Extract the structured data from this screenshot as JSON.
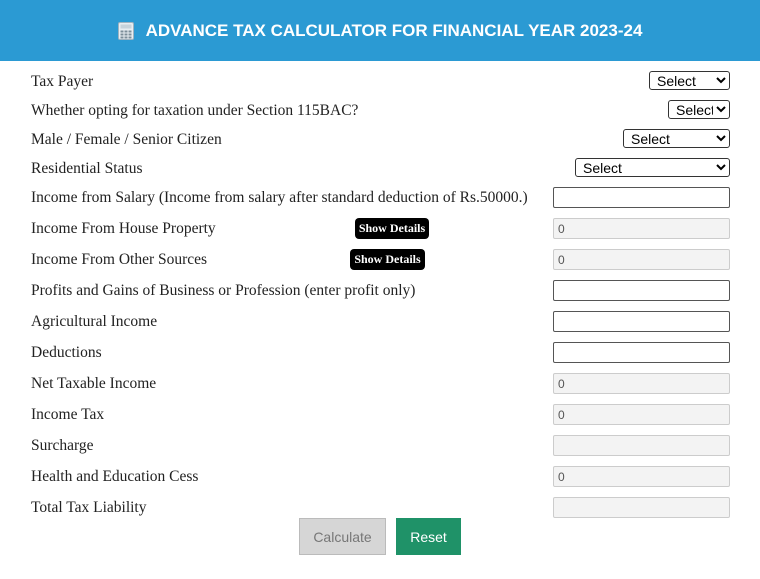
{
  "header": {
    "title": "ADVANCE TAX CALCULATOR FOR FINANCIAL YEAR 2023-24",
    "icon": "calculator-icon"
  },
  "fields": {
    "tax_payer": {
      "label": "Tax Payer",
      "value": "Select"
    },
    "section_115bac": {
      "label": "Whether opting for taxation under Section 115BAC?",
      "value": "Select"
    },
    "gender": {
      "label": "Male / Female / Senior Citizen",
      "value": "Select"
    },
    "residential_status": {
      "label": "Residential Status",
      "value": "Select"
    },
    "salary": {
      "label": "Income from Salary (Income from salary after standard deduction of Rs.50000.)",
      "value": ""
    },
    "house_property": {
      "label": "Income From House Property",
      "button": "Show Details",
      "value": "0"
    },
    "other_sources": {
      "label": "Income From Other Sources",
      "button": "Show Details",
      "value": "0"
    },
    "business": {
      "label": "Profits and Gains of Business or Profession (enter profit only)",
      "value": ""
    },
    "agricultural": {
      "label": "Agricultural Income",
      "value": ""
    },
    "deductions": {
      "label": "Deductions",
      "value": ""
    },
    "net_taxable": {
      "label": "Net Taxable Income",
      "value": "0"
    },
    "income_tax": {
      "label": "Income Tax",
      "value": "0"
    },
    "surcharge": {
      "label": "Surcharge",
      "value": ""
    },
    "cess": {
      "label": "Health and Education Cess",
      "value": "0"
    },
    "total_tax": {
      "label": "Total Tax Liability",
      "value": ""
    }
  },
  "buttons": {
    "calculate": "Calculate",
    "reset": "Reset"
  },
  "colors": {
    "header": "#2b9ad3",
    "reset": "#1f9268",
    "calculate": "#d6d6d6"
  }
}
